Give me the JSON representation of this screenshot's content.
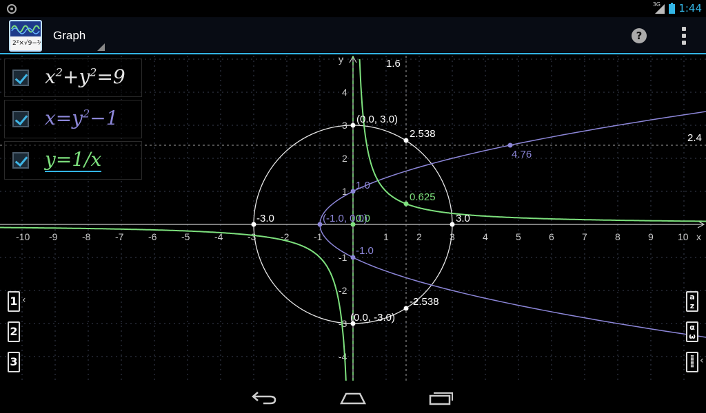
{
  "status": {
    "time": "1:44",
    "signal": "3G"
  },
  "app": {
    "title": "Graph"
  },
  "equations": [
    {
      "base": "x",
      "sup1": "2",
      "mid": "+y",
      "sup2": "2",
      "rest": "=9",
      "color": "#e6e6e6"
    },
    {
      "base": "x=y",
      "sup1": "2",
      "mid": "−1",
      "sup2": "",
      "rest": "",
      "color": "#8c86d8"
    },
    {
      "base": "y=1/x",
      "sup1": "",
      "mid": "",
      "sup2": "",
      "rest": "",
      "color": "#7de07d"
    }
  ],
  "left_keys": [
    "1",
    "2",
    "3"
  ],
  "right_keys": [
    "a/z",
    "α/ω",
    "keypad"
  ],
  "graph": {
    "axis_x_label": "x",
    "axis_y_label": "y",
    "tracer_x_label": "1.6",
    "tracer_y_label": "2.4",
    "x_tick_labels": [
      "-10",
      "-9",
      "-8",
      "-7",
      "-6",
      "-5",
      "-4",
      "-3",
      "-2",
      "-1",
      "1",
      "2",
      "3",
      "4",
      "5",
      "6",
      "7",
      "8",
      "9",
      "10"
    ],
    "y_tick_labels": [
      "4",
      "3",
      "2",
      "1",
      "-1",
      "-2",
      "-3",
      "-4"
    ],
    "point_labels": {
      "circle_top": "(0.0, 3.0)",
      "circle_bottom": "(0.0, -3.0)",
      "circle_left": "-3.0",
      "circle_right": "3.0",
      "circle_tracer_top": "2.538",
      "circle_tracer_bottom": "-2.538",
      "parab_vertex": "(-1.0, 0.0)",
      "parab_up": "1.0",
      "parab_down": "-1.0",
      "parab_tracer": "4.76",
      "hyp_tracer": "0.625",
      "origin": "0.0"
    }
  },
  "colors": {
    "circle": "#e6e6e6",
    "parabola": "#8c86d8",
    "hyperbola": "#7de07d",
    "accent": "#33b5e5"
  },
  "icons": [
    "back-icon",
    "home-icon",
    "recent-apps-icon",
    "help-icon",
    "overflow-menu-icon",
    "checkbox-icon"
  ]
}
